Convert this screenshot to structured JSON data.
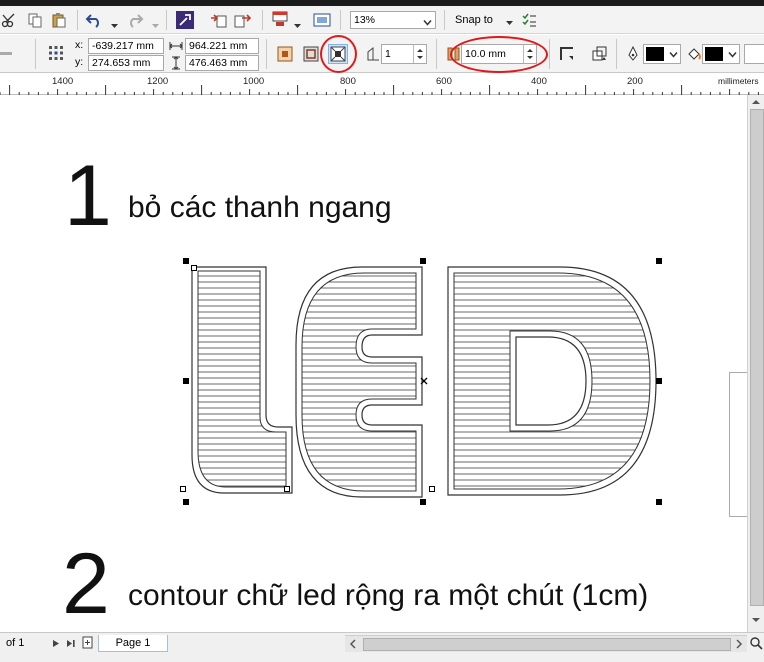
{
  "toolbar": {
    "zoom_value": "13%",
    "snap_label": "Snap to",
    "icons": [
      "scissors-icon",
      "copy-icon",
      "paste-icon",
      "undo-icon",
      "redo-icon",
      "import-icon",
      "export-icon",
      "publish-pdf-icon",
      "full-screen-icon",
      "view-mode-icon",
      "options-icon"
    ]
  },
  "property_bar": {
    "x_label": "x:",
    "x_value": "-639.217 mm",
    "y_label": "y:",
    "y_value": "274.653 mm",
    "width_value": "964.221 mm",
    "height_value": "476.463 mm",
    "steps_value": "1",
    "offset_value": "10.0 mm",
    "outline_color": "#000000",
    "fill_color": "#000000",
    "highlight_color": "#e0191b"
  },
  "ruler": {
    "labels": [
      "1400",
      "1200",
      "1000",
      "800",
      "600",
      "400",
      "200"
    ],
    "units": "millimeters"
  },
  "canvas": {
    "step1_number": "1",
    "step1_text": "bỏ các thanh ngang",
    "step2_number": "2",
    "step2_text": "contour chữ led rộng ra một chút (1cm)"
  },
  "statusbar": {
    "page_count": "of 1",
    "page_tab": "Page 1"
  }
}
